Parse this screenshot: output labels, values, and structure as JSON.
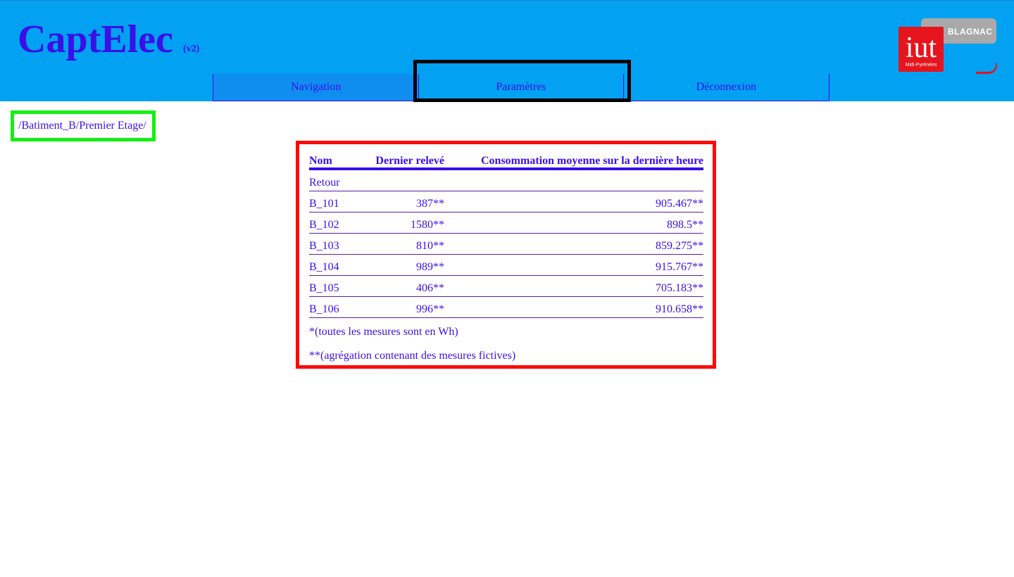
{
  "header": {
    "title": "CaptElec",
    "version": "(v2)",
    "logo": {
      "brand": "iut",
      "subtitle": "Midi-Pyrénées",
      "campus": "BLAGNAC"
    }
  },
  "nav": {
    "items": [
      {
        "label": "Navigation",
        "state": "active"
      },
      {
        "label": "Paramètres",
        "state": "focused"
      },
      {
        "label": "Déconnexion",
        "state": "normal"
      }
    ]
  },
  "breadcrumb": "/Batiment_B/Premier Etage/",
  "table": {
    "columns": [
      "Nom",
      "Dernier relevé",
      "Consommation moyenne sur la dernière heure"
    ],
    "back_label": "Retour",
    "rows": [
      [
        "B_101",
        "387**",
        "905.467**"
      ],
      [
        "B_102",
        "1580**",
        "898.5**"
      ],
      [
        "B_103",
        "810**",
        "859.275**"
      ],
      [
        "B_104",
        "989**",
        "915.767**"
      ],
      [
        "B_105",
        "406**",
        "705.183**"
      ],
      [
        "B_106",
        "996**",
        "910.658**"
      ]
    ]
  },
  "notes": {
    "unit": "*(toutes les mesures sont en Wh)",
    "fictive": "**(agrégation contenant des mesures fictives)"
  },
  "colors": {
    "header_bg": "#03a1f1",
    "text": "#3a0fe8",
    "highlight_nav": "#000000",
    "highlight_breadcrumb": "#15ee15",
    "highlight_table": "#ff0a0a"
  }
}
